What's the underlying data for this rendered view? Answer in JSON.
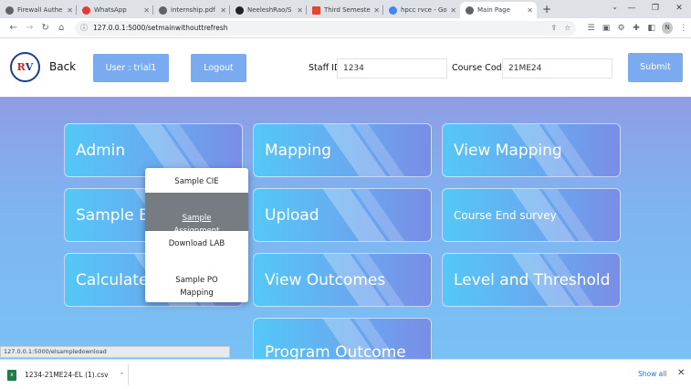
{
  "browser": {
    "tabs": [
      {
        "label": "Firewall Authe",
        "favicon_color": "#5f6368"
      },
      {
        "label": "WhatsApp",
        "favicon_color": "#e53935"
      },
      {
        "label": "internship.pdf",
        "favicon_color": "#5f6368"
      },
      {
        "label": "NeeleshRao/S",
        "favicon_color": "#202124"
      },
      {
        "label": "Third Semeste",
        "favicon_color": "#ea4335"
      },
      {
        "label": "hpcc rvce - Go",
        "favicon_color": "#4285f4"
      },
      {
        "label": "Main Page",
        "favicon_color": "#5f6368"
      }
    ],
    "active_tab_index": 6,
    "url": "127.0.0.1:5000/setmainwithouttrefresh",
    "profile_initial": "N"
  },
  "header": {
    "logo_text": "RV",
    "back_label": "Back",
    "user_label": "User : trial1",
    "logout_label": "Logout",
    "staff_id_label": "Staff ID",
    "staff_id_value": "1234",
    "course_code_label": "Course Code",
    "course_code_value": "21ME24",
    "submit_label": "Submit"
  },
  "cards": [
    {
      "label": "Admin"
    },
    {
      "label": "Mapping"
    },
    {
      "label": "View Mapping"
    },
    {
      "label": "Sample Ex"
    },
    {
      "label": "Upload"
    },
    {
      "label": "Course End survey"
    },
    {
      "label": "Calculate"
    },
    {
      "label": "View Outcomes"
    },
    {
      "label": "Level and Threshold"
    },
    {
      "label": "Program Outcome"
    }
  ],
  "dropdown": {
    "items": [
      {
        "label": "Sample CIE"
      },
      {
        "label": "Sample\nAssignment"
      },
      {
        "label": "Download LAB"
      },
      {
        "label": "Sample PO\nMapping"
      }
    ],
    "highlighted_index": 1
  },
  "status_url": "127.0.0.1:5000/elsampledownload",
  "downloads": {
    "file_name": "1234-21ME24-EL (1).csv",
    "show_all_label": "Show all"
  },
  "colors": {
    "accent_button": "#7aaaf0",
    "card_start": "#54c8f7",
    "card_end": "#7a8de6",
    "highlight": "#777c83"
  }
}
